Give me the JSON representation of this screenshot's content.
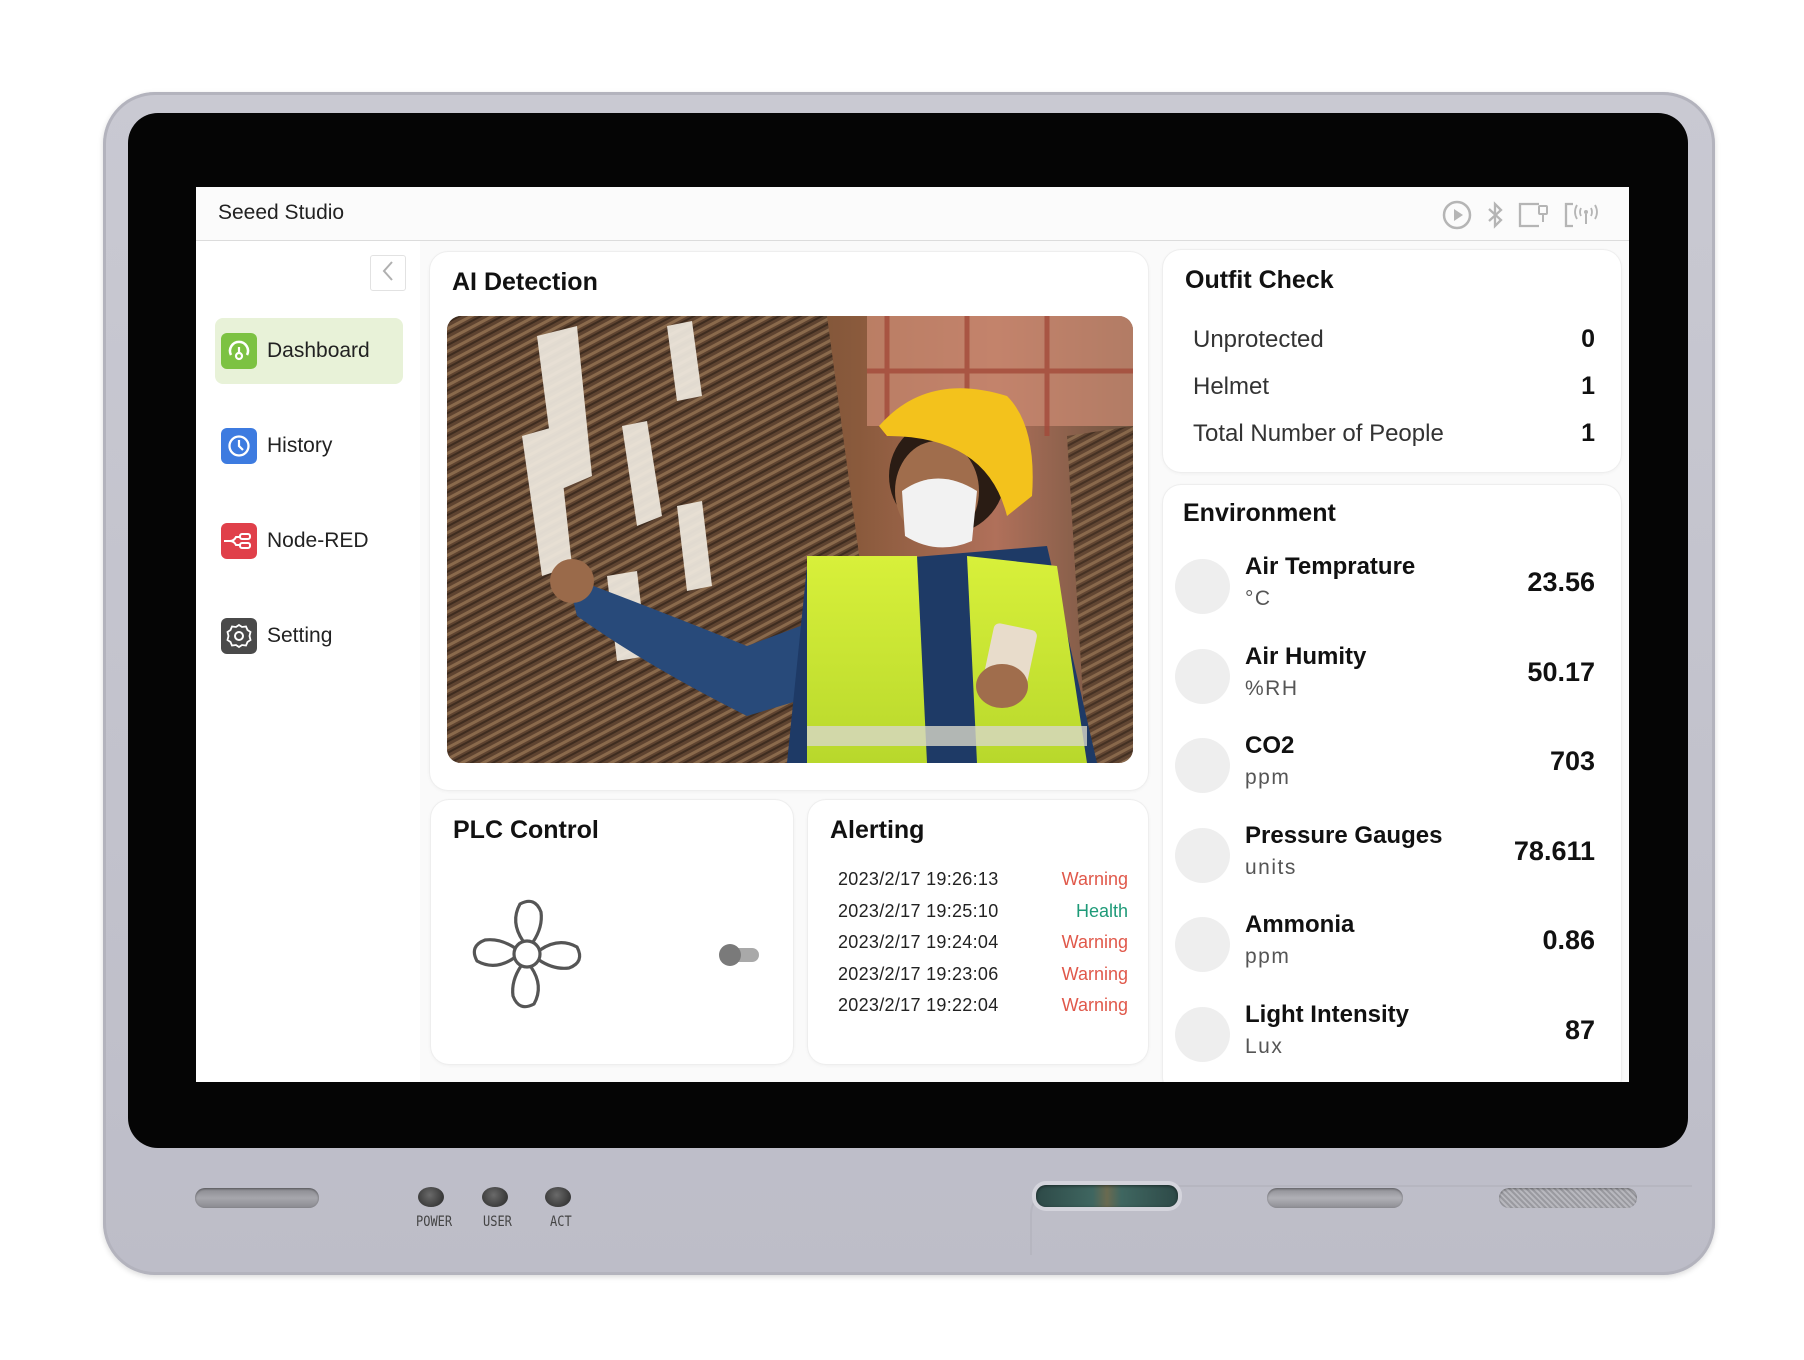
{
  "header": {
    "brand": "Seeed Studio",
    "status_icons": [
      "play-circle-icon",
      "bluetooth-icon",
      "ethernet-icon",
      "wireless-icon"
    ]
  },
  "sidebar": {
    "collapse_icon": "chevron-left-icon",
    "items": [
      {
        "label": "Dashboard",
        "icon": "dashboard-gauge-icon",
        "color": "#7cc242",
        "active": true
      },
      {
        "label": "History",
        "icon": "clock-icon",
        "color": "#3d7be0",
        "active": false
      },
      {
        "label": "Node-RED",
        "icon": "node-red-icon",
        "color": "#e0404a",
        "active": false
      },
      {
        "label": "Setting",
        "icon": "gear-icon",
        "color": "#4a4a4a",
        "active": false
      }
    ]
  },
  "ai_detection": {
    "title": "AI Detection",
    "image_alt": "Worker wearing yellow helmet, mask and hi-vis vest in warehouse"
  },
  "plc_control": {
    "title": "PLC Control",
    "device_icon": "fan-icon",
    "toggle_on": false
  },
  "alerting": {
    "title": "Alerting",
    "rows": [
      {
        "time": "2023/2/17 19:26:13",
        "status": "Warning",
        "type": "warning"
      },
      {
        "time": "2023/2/17 19:25:10",
        "status": "Health",
        "type": "health"
      },
      {
        "time": "2023/2/17 19:24:04",
        "status": "Warning",
        "type": "warning"
      },
      {
        "time": "2023/2/17 19:23:06",
        "status": "Warning",
        "type": "warning"
      },
      {
        "time": "2023/2/17 19:22:04",
        "status": "Warning",
        "type": "warning"
      }
    ],
    "colors": {
      "warning": "#e0584a",
      "health": "#1e9a78"
    }
  },
  "outfit_check": {
    "title": "Outfit Check",
    "rows": [
      {
        "label": "Unprotected",
        "value": "0"
      },
      {
        "label": "Helmet",
        "value": "1"
      },
      {
        "label": "Total Number of People",
        "value": "1"
      }
    ]
  },
  "environment": {
    "title": "Environment",
    "rows": [
      {
        "name": "Air Temprature",
        "unit": "°C",
        "value": "23.56"
      },
      {
        "name": "Air Humity",
        "unit": "%RH",
        "value": "50.17"
      },
      {
        "name": "CO2",
        "unit": "ppm",
        "value": "703"
      },
      {
        "name": "Pressure Gauges",
        "unit": "units",
        "value": "78.611"
      },
      {
        "name": "Ammonia",
        "unit": "ppm",
        "value": "0.86"
      },
      {
        "name": "Light Intensity",
        "unit": "Lux",
        "value": "87"
      }
    ]
  },
  "device": {
    "led_labels": [
      "POWER",
      "USER",
      "ACT"
    ]
  }
}
